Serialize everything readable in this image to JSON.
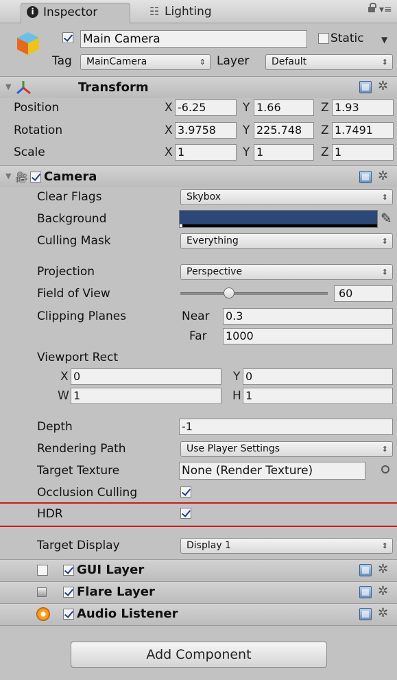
{
  "tabs": [
    {
      "label": "Inspector",
      "icon": "info-icon"
    },
    {
      "label": "Lighting",
      "icon": "lighting-icon"
    }
  ],
  "object": {
    "name": "Main Camera",
    "active": true,
    "static_label": "Static",
    "tag_label": "Tag",
    "tag_value": "MainCamera",
    "layer_label": "Layer",
    "layer_value": "Default"
  },
  "transform": {
    "title": "Transform",
    "position_label": "Position",
    "rotation_label": "Rotation",
    "scale_label": "Scale",
    "x": "X",
    "y": "Y",
    "z": "Z",
    "position": {
      "x": "-6.25",
      "y": "1.66",
      "z": "1.93"
    },
    "rotation": {
      "x": "3.9758",
      "y": "225.748",
      "z": "1.7491"
    },
    "scale": {
      "x": "1",
      "y": "1",
      "z": "1"
    }
  },
  "camera": {
    "title": "Camera",
    "clear_flags_label": "Clear Flags",
    "clear_flags": "Skybox",
    "background_label": "Background",
    "background_color": "#2b4878",
    "culling_mask_label": "Culling Mask",
    "culling_mask": "Everything",
    "projection_label": "Projection",
    "projection": "Perspective",
    "fov_label": "Field of View",
    "fov": "60",
    "fov_fraction": 0.33,
    "clipping_label": "Clipping Planes",
    "near_label": "Near",
    "near": "0.3",
    "far_label": "Far",
    "far": "1000",
    "viewport_label": "Viewport Rect",
    "vx_label": "X",
    "vx": "0",
    "vy_label": "Y",
    "vy": "0",
    "vw_label": "W",
    "vw": "1",
    "vh_label": "H",
    "vh": "1",
    "depth_label": "Depth",
    "depth": "-1",
    "rendering_path_label": "Rendering Path",
    "rendering_path": "Use Player Settings",
    "target_texture_label": "Target Texture",
    "target_texture": "None (Render Texture)",
    "occlusion_label": "Occlusion Culling",
    "occlusion": true,
    "hdr_label": "HDR",
    "hdr": true,
    "target_display_label": "Target Display",
    "target_display": "Display 1"
  },
  "components": [
    {
      "label": "GUI Layer",
      "icon": "gui-layer-icon"
    },
    {
      "label": "Flare Layer",
      "icon": "flare-layer-icon"
    },
    {
      "label": "Audio Listener",
      "icon": "audio-listener-icon"
    }
  ],
  "add_component_label": "Add Component",
  "colors": {
    "panel": "#c2c2c2",
    "highlight_line": "#d21818"
  }
}
